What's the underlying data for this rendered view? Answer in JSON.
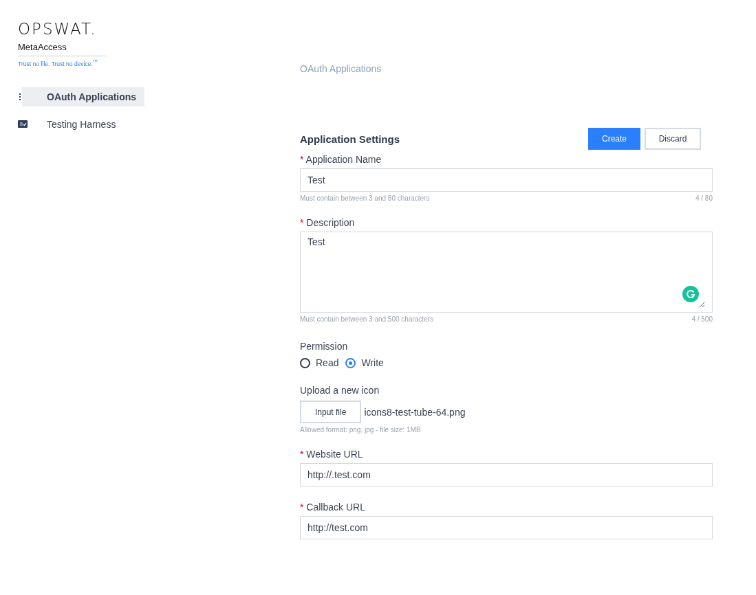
{
  "brand": {
    "logo": "OPSWAT.",
    "product": "MetaAccess",
    "tagline": "Trust no file. Trust no device.$^{™}$"
  },
  "sidebar": {
    "items": [
      {
        "kind": "grid",
        "label": "OAuth Applications",
        "selected": true
      },
      {
        "kind": "checklist",
        "label": "Testing Harness",
        "selected": false
      }
    ]
  },
  "page_title": "OAuth Applications",
  "form": {
    "title": "Application Settings",
    "buttons": [
      {
        "kind": "primary",
        "label": "Create"
      },
      {
        "kind": "secondary",
        "label": "Discard"
      }
    ],
    "fields": [
      {
        "kind": "input",
        "mark": "*",
        "label": "Application Name",
        "value": "Test",
        "hint": "Must contain between 3 and 80 characters",
        "count": "4 / 80"
      },
      {
        "kind": "textarea",
        "mark": "*",
        "label": "Description",
        "value": "Test",
        "hint": "Must contain between 3 and 500 characters",
        "count": "4 / 500"
      },
      {
        "kind": "radio",
        "label": "Permission",
        "options": [
          {
            "label": "Read",
            "selected": false
          },
          {
            "label": "Write",
            "selected": true
          }
        ]
      },
      {
        "kind": "file",
        "label": "Upload a new icon",
        "button": "Input file",
        "filename": "icons8-test-tube-64.png",
        "hint": "Allowed format: png, jpg - file size: 1MB"
      },
      {
        "kind": "input",
        "mark": "*",
        "label": "Website URL",
        "value": "http://.test.com"
      },
      {
        "kind": "input",
        "mark": "*",
        "label": "Callback URL",
        "value": "http://test.com"
      }
    ]
  }
}
